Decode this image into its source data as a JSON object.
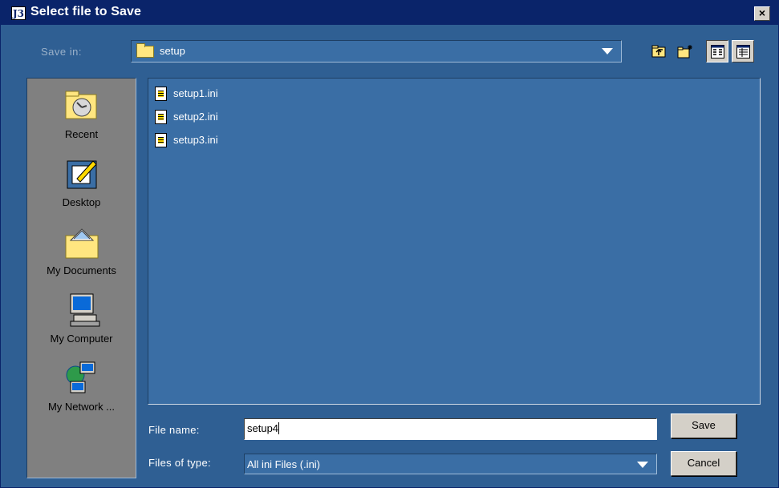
{
  "window": {
    "title": "Select file to Save",
    "app_icon_text": "J3",
    "close_label": "×"
  },
  "toolbar": {
    "save_in_label": "Save in:",
    "save_in_value": "setup",
    "icons": [
      "folder-up-icon",
      "new-folder-icon",
      "list-view-icon",
      "details-view-icon"
    ]
  },
  "places": [
    {
      "label": "Recent",
      "icon": "recent-icon"
    },
    {
      "label": "Desktop",
      "icon": "desktop-icon"
    },
    {
      "label": "My Documents",
      "icon": "my-documents-icon"
    },
    {
      "label": "My Computer",
      "icon": "my-computer-icon"
    },
    {
      "label": "My Network ...",
      "icon": "my-network-icon"
    }
  ],
  "files": [
    {
      "name": "setup1.ini"
    },
    {
      "name": "setup2.ini"
    },
    {
      "name": "setup3.ini"
    }
  ],
  "form": {
    "file_name_label": "File name:",
    "file_name_value": "setup4",
    "file_type_label": "Files of type:",
    "file_type_value": "All ini Files (.ini)"
  },
  "buttons": {
    "save": "Save",
    "cancel": "Cancel"
  },
  "colors": {
    "background": "#2f5f93",
    "title_bar": "#0a246a",
    "list_bg": "#3a6ea5",
    "places_bg": "#808080"
  }
}
